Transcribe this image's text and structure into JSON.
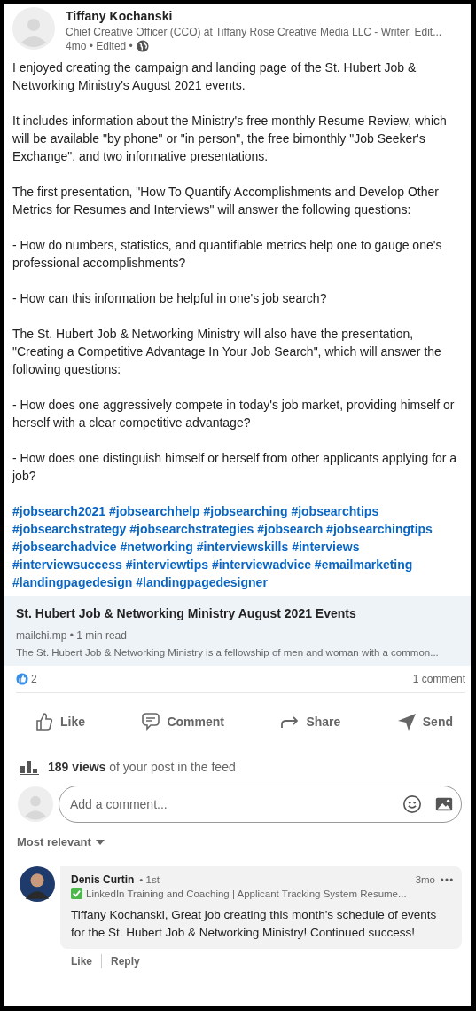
{
  "author": {
    "name": "Tiffany Kochanski",
    "headline": "Chief Creative Officer (CCO) at Tiffany Rose Creative Media LLC - Writer, Edit...",
    "meta": "4mo • Edited •"
  },
  "paragraphs": [
    "I enjoyed creating the campaign and landing page of the St. Hubert Job & Networking Ministry's August 2021 events.",
    "It includes information about the Ministry's free monthly Resume Review, which will be available \"by phone\" or \"in person\", the free bimonthly \"Job Seeker's Exchange\", and two informative presentations.",
    "The first presentation, \"How To Quantify Accomplishments and Develop Other Metrics for Resumes and Interviews\" will answer the following questions:",
    "- How do numbers, statistics, and quantifiable metrics help one to gauge one's professional accomplishments?",
    "- How can this information be helpful in one's job search?",
    "The St. Hubert Job & Networking Ministry will also have the presentation, \"Creating a Competitive Advantage In Your Job Search\", which will answer the following questions:",
    "- How does one aggressively compete in today's job market, providing himself or herself with a clear competitive advantage?",
    "- How does one distinguish himself or herself from other applicants applying for a job?"
  ],
  "hashtags": [
    "#jobsearch2021",
    "#jobsearchhelp",
    "#jobsearching",
    "#jobsearchtips",
    "#jobsearchstrategy",
    "#jobsearchstrategies",
    "#jobsearch",
    "#jobsearchingtips",
    "#jobsearchadvice",
    "#networking",
    "#interviewskills",
    "#interviews",
    "#interviewsuccess",
    "#interviewtips",
    "#interviewadvice",
    "#emailmarketing",
    "#landingpagedesign",
    "#landingpagedesigner"
  ],
  "link_preview": {
    "title": "St. Hubert Job & Networking Ministry August 2021 Events",
    "source": "mailchi.mp • 1 min read",
    "description": "The St. Hubert Job & Networking Ministry is a fellowship of men and woman with a common..."
  },
  "social": {
    "reactions": "2",
    "comments": "1 comment"
  },
  "actions": [
    {
      "kind": "like",
      "label": "Like"
    },
    {
      "kind": "comment",
      "label": "Comment"
    },
    {
      "kind": "share",
      "label": "Share"
    },
    {
      "kind": "send",
      "label": "Send"
    }
  ],
  "views": "**189 views** of your post in the feed",
  "comment_box": {
    "placeholder": "Add a comment..."
  },
  "sort": "Most relevant",
  "comments": [
    {
      "name": "Denis Curtin",
      "degree": "• 1st",
      "headline": "LinkedIn Training and Coaching | Applicant Tracking System Resume...",
      "time": "3mo",
      "text": "Tiffany Kochanski, Great job creating this month's schedule of events for the St. Hubert Job & Networking Ministry! Continued success!",
      "actions": [
        "Like",
        "Reply"
      ]
    }
  ]
}
